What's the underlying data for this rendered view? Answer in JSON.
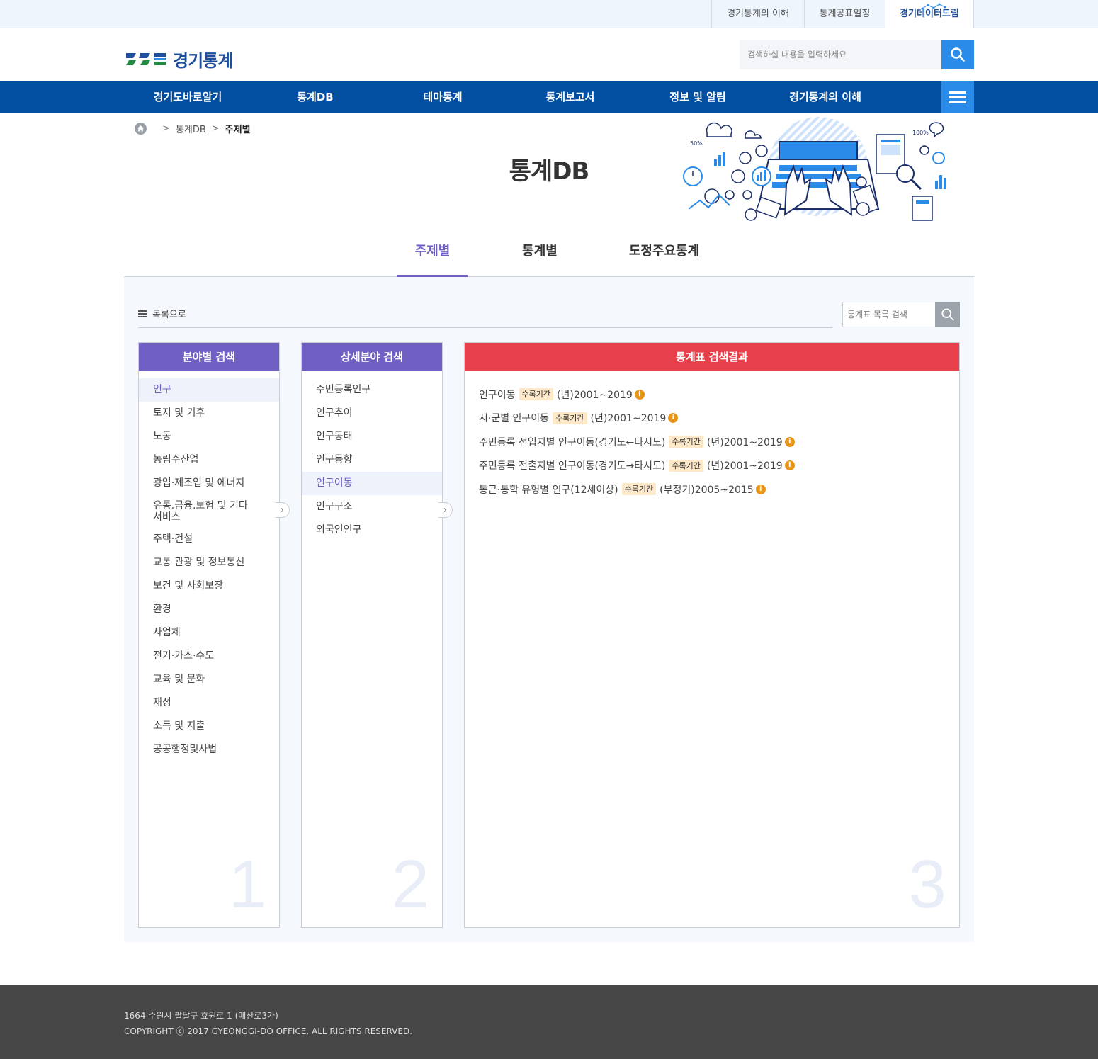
{
  "topbar": {
    "links": [
      "경기통계의 이해",
      "통계공표일정",
      "경기데이터드림"
    ]
  },
  "header": {
    "logo_text": "경기통계",
    "search_placeholder": "검색하실 내용을 입력하세요"
  },
  "gnb": {
    "items": [
      "경기도바로알기",
      "통계DB",
      "테마통계",
      "통계보고서",
      "정보 및 알림",
      "경기통계의 이해"
    ]
  },
  "breadcrumb": {
    "items": [
      "통계DB",
      "주제별"
    ]
  },
  "page": {
    "title": "통계DB"
  },
  "tabs": [
    "주제별",
    "통계별",
    "도정주요통계"
  ],
  "toolbar": {
    "list_label": "목록으로",
    "search_placeholder": "통계표 목록 검색"
  },
  "col1": {
    "title": "분야별 검색",
    "items": [
      "인구",
      "토지 및 기후",
      "노동",
      "농림수산업",
      "광업·제조업 및 에너지",
      "유통.금융.보험 및 기타 서비스",
      "주택·건설",
      "교통 관광 및 정보통신",
      "보건 및 사회보장",
      "환경",
      "사업체",
      "전기·가스·수도",
      "교육 및 문화",
      "재정",
      "소득 및 지출",
      "공공행정및사법"
    ],
    "number": "1"
  },
  "col2": {
    "title": "상세분야 검색",
    "items": [
      "주민등록인구",
      "인구추이",
      "인구동태",
      "인구동향",
      "인구이동",
      "인구구조",
      "외국인인구"
    ],
    "number": "2"
  },
  "col3": {
    "title": "통계표 검색결과",
    "number": "3",
    "results": [
      {
        "name": "인구이동",
        "badge": "수록기간",
        "period": "(년)2001~2019"
      },
      {
        "name": "시·군별 인구이동",
        "badge": "수록기간",
        "period": "(년)2001~2019"
      },
      {
        "name": "주민등록 전입지별 인구이동(경기도←타시도)",
        "badge": "수록기간",
        "period": "(년)2001~2019"
      },
      {
        "name": "주민등록 전출지별 인구이동(경기도→타시도)",
        "badge": "수록기간",
        "period": "(년)2001~2019"
      },
      {
        "name": "통근·통학 유형별 인구(12세이상)",
        "badge": "수록기간",
        "period": "(부정기)2005~2015"
      }
    ]
  },
  "hero": {
    "label_50": "50%",
    "label_100": "100%"
  },
  "footer": {
    "address": "1664 수원시 팔달구 효원로 1 (매산로3가)",
    "copyright": "COPYRIGHT ⓒ 2017 GYEONGGI-DO OFFICE. ALL RIGHTS RESERVED."
  },
  "colors": {
    "primary": "#024fa2",
    "accent": "#2b8be8",
    "purple": "#7160c4",
    "red": "#e8404a"
  }
}
